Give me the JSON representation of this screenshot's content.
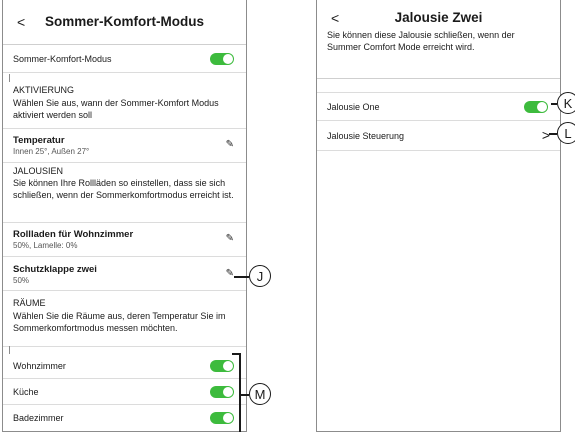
{
  "left": {
    "title": "Sommer-Komfort-Modus",
    "back": "<",
    "main_toggle_label": "Sommer-Komfort-Modus",
    "aktivierung": {
      "heading": "AKTIVIERUNG",
      "text": "Wählen Sie aus, wann der Sommer-Komfort Modus aktiviert werden soll"
    },
    "temperatur": {
      "label": "Temperatur",
      "value": "Innen 25°, Außen 27°"
    },
    "jalousien": {
      "heading": "JALOUSIEN",
      "text": "Sie können Ihre Rollläden so einstellen, dass sie sich schließen, wenn der Sommerkomfortmodus erreicht ist."
    },
    "blinds": [
      {
        "label": "Rollladen für Wohnzimmer",
        "value": "50%, Lamelle: 0%"
      },
      {
        "label": "Schutzklappe zwei",
        "value": "50%"
      }
    ],
    "raeume": {
      "heading": "RÄUME",
      "text": "Wählen Sie die Räume aus, deren Temperatur Sie im Sommerkomfortmodus messen möchten."
    },
    "rooms": [
      {
        "label": "Wohnzimmer",
        "on": true
      },
      {
        "label": "Küche",
        "on": true
      },
      {
        "label": "Badezimmer",
        "on": true
      }
    ]
  },
  "right": {
    "title": "Jalousie Zwei",
    "back": "<",
    "description": "Sie können diese Jalousie schließen, wenn der Summer Comfort Mode erreicht wird.",
    "toggle_label": "Jalousie One",
    "nav_label": "Jalousie Steuerung"
  },
  "callouts": {
    "J": "J",
    "M": "M",
    "K": "K",
    "L": "L"
  },
  "colors": {
    "toggle_on": "#3dbb3d"
  }
}
